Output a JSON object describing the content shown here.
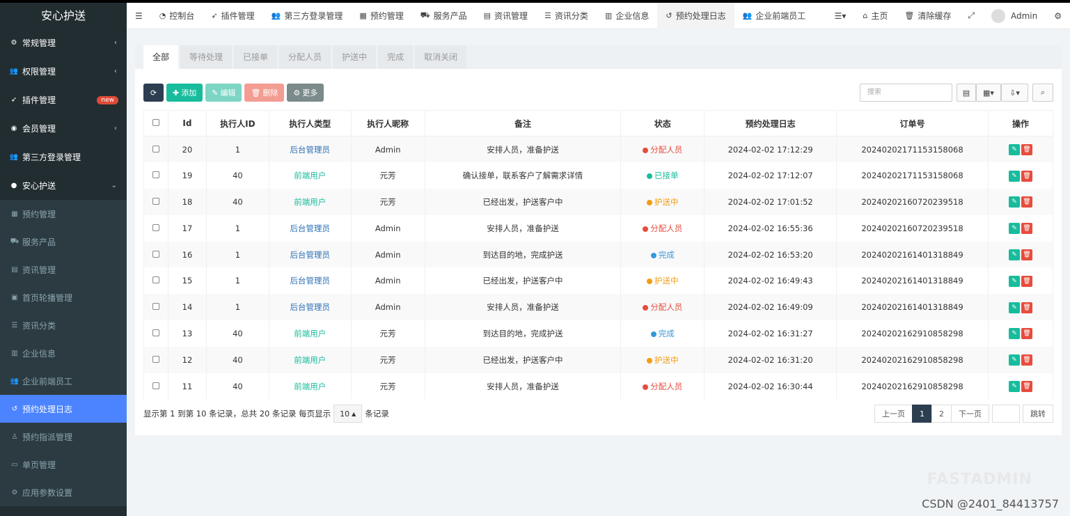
{
  "app": {
    "title": "安心护送"
  },
  "sidebar": {
    "menu": [
      {
        "label": "常规管理",
        "icon": "cogs-icon",
        "caret": "‹"
      },
      {
        "label": "权限管理",
        "icon": "group-icon",
        "caret": "‹"
      },
      {
        "label": "插件管理",
        "icon": "rocket-icon",
        "badge": "new"
      },
      {
        "label": "会员管理",
        "icon": "user-circle-icon",
        "caret": "‹"
      },
      {
        "label": "第三方登录管理",
        "icon": "group-icon"
      },
      {
        "label": "安心护送",
        "icon": "circle-icon",
        "caret": "⌄"
      }
    ],
    "submenu": [
      {
        "label": "预约管理",
        "icon": "calendar-icon"
      },
      {
        "label": "服务产品",
        "icon": "truck-icon"
      },
      {
        "label": "资讯管理",
        "icon": "newspaper-icon"
      },
      {
        "label": "首页轮播管理",
        "icon": "image-icon"
      },
      {
        "label": "资讯分类",
        "icon": "list-icon"
      },
      {
        "label": "企业信息",
        "icon": "building-icon"
      },
      {
        "label": "企业前端员工",
        "icon": "group-icon"
      },
      {
        "label": "预约处理日志",
        "icon": "history-icon",
        "active": true
      },
      {
        "label": "预约指派管理",
        "icon": "user-icon"
      },
      {
        "label": "单页管理",
        "icon": "file-icon"
      },
      {
        "label": "应用参数设置",
        "icon": "cog-icon"
      }
    ]
  },
  "topbar": {
    "tabs": [
      {
        "label": "控制台",
        "icon": "dashboard-icon"
      },
      {
        "label": "插件管理",
        "icon": "rocket-icon"
      },
      {
        "label": "第三方登录管理",
        "icon": "group-icon"
      },
      {
        "label": "预约管理",
        "icon": "calendar-icon"
      },
      {
        "label": "服务产品",
        "icon": "truck-icon"
      },
      {
        "label": "资讯管理",
        "icon": "newspaper-icon"
      },
      {
        "label": "资讯分类",
        "icon": "list-icon"
      },
      {
        "label": "企业信息",
        "icon": "building-icon"
      },
      {
        "label": "预约处理日志",
        "icon": "history-icon",
        "active": true
      },
      {
        "label": "企业前端员工",
        "icon": "group-icon"
      }
    ],
    "home_label": "主页",
    "clear_cache_label": "清除缓存",
    "user_name": "Admin"
  },
  "filter_tabs": [
    "全部",
    "等待处理",
    "已接单",
    "分配人员",
    "护送中",
    "完成",
    "取消关闭"
  ],
  "toolbar": {
    "add_label": "添加",
    "edit_label": "编辑",
    "delete_label": "删除",
    "more_label": "更多",
    "search_placeholder": "搜索"
  },
  "table": {
    "headers": [
      "Id",
      "执行人ID",
      "执行人类型",
      "执行人昵称",
      "备注",
      "状态",
      "预约处理日志",
      "订单号",
      "操作"
    ],
    "rows": [
      {
        "id": "20",
        "exec_id": "1",
        "type": "后台管理员",
        "type_kind": "admin",
        "nick": "Admin",
        "note": "安排人员，准备护送",
        "status": "分配人员",
        "status_color": "#e74c3c",
        "time": "2024-02-02 17:12:29",
        "order": "20240202171153158068"
      },
      {
        "id": "19",
        "exec_id": "40",
        "type": "前端用户",
        "type_kind": "front",
        "nick": "元芳",
        "note": "确认接单，联系客户了解需求详情",
        "status": "已接单",
        "status_color": "#18bc9c",
        "time": "2024-02-02 17:12:07",
        "order": "20240202171153158068"
      },
      {
        "id": "18",
        "exec_id": "40",
        "type": "前端用户",
        "type_kind": "front",
        "nick": "元芳",
        "note": "已经出发，护送客户中",
        "status": "护送中",
        "status_color": "#f39c12",
        "time": "2024-02-02 17:01:52",
        "order": "20240202160720239518"
      },
      {
        "id": "17",
        "exec_id": "1",
        "type": "后台管理员",
        "type_kind": "admin",
        "nick": "Admin",
        "note": "安排人员，准备护送",
        "status": "分配人员",
        "status_color": "#e74c3c",
        "time": "2024-02-02 16:55:36",
        "order": "20240202160720239518"
      },
      {
        "id": "16",
        "exec_id": "1",
        "type": "后台管理员",
        "type_kind": "admin",
        "nick": "Admin",
        "note": "到达目的地，完成护送",
        "status": "完成",
        "status_color": "#3498db",
        "time": "2024-02-02 16:53:20",
        "order": "20240202161401318849"
      },
      {
        "id": "15",
        "exec_id": "1",
        "type": "后台管理员",
        "type_kind": "admin",
        "nick": "Admin",
        "note": "已经出发，护送客户中",
        "status": "护送中",
        "status_color": "#f39c12",
        "time": "2024-02-02 16:49:43",
        "order": "20240202161401318849"
      },
      {
        "id": "14",
        "exec_id": "1",
        "type": "后台管理员",
        "type_kind": "admin",
        "nick": "Admin",
        "note": "安排人员，准备护送",
        "status": "分配人员",
        "status_color": "#e74c3c",
        "time": "2024-02-02 16:49:09",
        "order": "20240202161401318849"
      },
      {
        "id": "13",
        "exec_id": "40",
        "type": "前端用户",
        "type_kind": "front",
        "nick": "元芳",
        "note": "到达目的地，完成护送",
        "status": "完成",
        "status_color": "#3498db",
        "time": "2024-02-02 16:31:27",
        "order": "20240202162910858298"
      },
      {
        "id": "12",
        "exec_id": "40",
        "type": "前端用户",
        "type_kind": "front",
        "nick": "元芳",
        "note": "已经出发，护送客户中",
        "status": "护送中",
        "status_color": "#f39c12",
        "time": "2024-02-02 16:31:20",
        "order": "20240202162910858298"
      },
      {
        "id": "11",
        "exec_id": "40",
        "type": "前端用户",
        "type_kind": "front",
        "nick": "元芳",
        "note": "安排人员，准备护送",
        "status": "分配人员",
        "status_color": "#e74c3c",
        "time": "2024-02-02 16:30:44",
        "order": "20240202162910858298"
      }
    ]
  },
  "pagination": {
    "summary_prefix": "显示第 1 到第 10 条记录，总共 20 条记录 每页显示",
    "page_size": "10",
    "summary_suffix": "条记录",
    "prev_label": "上一页",
    "pages": [
      "1",
      "2"
    ],
    "current_page": "1",
    "next_label": "下一页",
    "go_label": "跳转"
  },
  "watermark": {
    "text": "CSDN @2401_84413757",
    "faint_logo": "FASTADMIN"
  }
}
